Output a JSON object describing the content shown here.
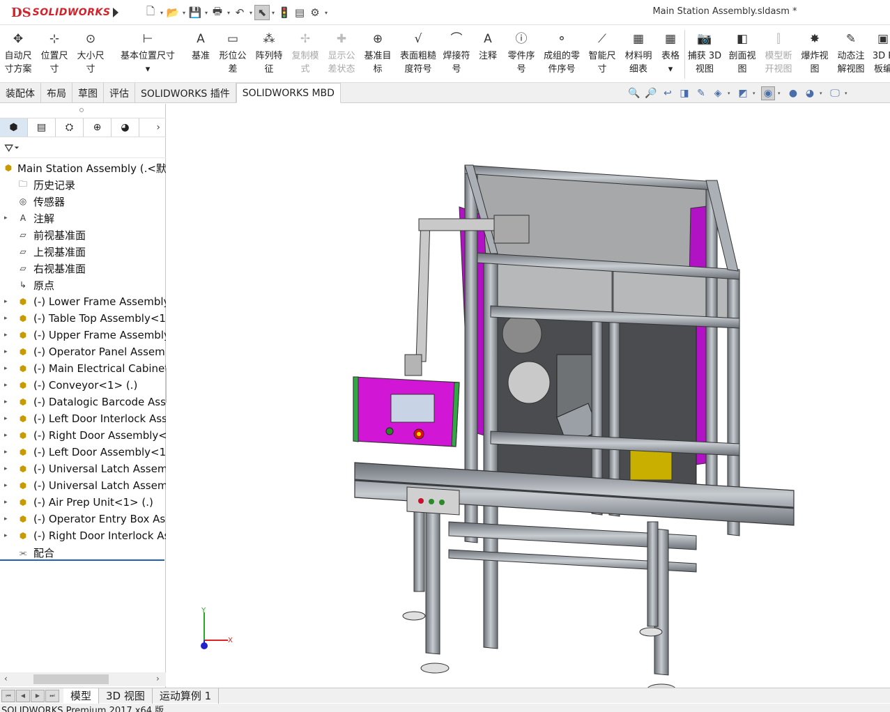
{
  "app": {
    "brand_ds": "DS",
    "brand_name": "SOLIDWORKS",
    "document_title": "Main Station Assembly.sldasm *"
  },
  "quick_access": [
    {
      "name": "new-icon",
      "glyph": "🗋"
    },
    {
      "name": "open-icon",
      "glyph": "📂"
    },
    {
      "name": "save-icon",
      "glyph": "💾"
    },
    {
      "name": "print-icon",
      "glyph": "🖶"
    },
    {
      "name": "undo-icon",
      "glyph": "↶"
    },
    {
      "name": "select-icon",
      "glyph": "⬉"
    },
    {
      "name": "rebuild-icon",
      "glyph": "🚦"
    },
    {
      "name": "file-properties-icon",
      "glyph": "▤"
    },
    {
      "name": "options-icon",
      "glyph": "⚙"
    }
  ],
  "ribbon": [
    {
      "l1": "自动尺",
      "l2": "寸方案",
      "icon": "auto-dimension-icon",
      "glyph": "✥"
    },
    {
      "l1": "位置尺",
      "l2": "寸",
      "icon": "location-dimension-icon",
      "glyph": "⊹"
    },
    {
      "l1": "大小尺",
      "l2": "寸",
      "icon": "size-dimension-icon",
      "glyph": "⊙"
    },
    {
      "l1": "基本位置尺寸",
      "l2": "▾",
      "icon": "basic-location-dimension-icon",
      "glyph": "⊢"
    },
    {
      "l1": "基准",
      "l2": "",
      "icon": "datum-icon",
      "glyph": "A"
    },
    {
      "l1": "形位公",
      "l2": "差",
      "icon": "geometric-tolerance-icon",
      "glyph": "▭"
    },
    {
      "l1": "阵列特",
      "l2": "征",
      "icon": "pattern-feature-icon",
      "glyph": "⁂"
    },
    {
      "l1": "复制模",
      "l2": "式",
      "icon": "copy-scheme-icon",
      "glyph": "✢",
      "disabled": true
    },
    {
      "l1": "显示公",
      "l2": "差状态",
      "icon": "show-tolerance-status-icon",
      "glyph": "✚",
      "disabled": true
    },
    {
      "l1": "基准目",
      "l2": "标",
      "icon": "datum-target-icon",
      "glyph": "⊕"
    },
    {
      "l1": "表面粗糙",
      "l2": "度符号",
      "icon": "surface-finish-icon",
      "glyph": "√"
    },
    {
      "l1": "焊接符",
      "l2": "号",
      "icon": "weld-symbol-icon",
      "glyph": "⌒"
    },
    {
      "l1": "注释",
      "l2": "",
      "icon": "note-icon",
      "glyph": "A"
    },
    {
      "l1": "零件序",
      "l2": "号",
      "icon": "balloon-icon",
      "glyph": "ⓘ"
    },
    {
      "l1": "成组的零",
      "l2": "件序号",
      "icon": "stacked-balloon-icon",
      "glyph": "⚬"
    },
    {
      "l1": "智能尺",
      "l2": "寸",
      "icon": "smart-dimension-icon",
      "glyph": "⟋"
    },
    {
      "l1": "材料明",
      "l2": "细表",
      "icon": "bom-icon",
      "glyph": "▦"
    },
    {
      "l1": "表格",
      "l2": "▾",
      "icon": "table-icon",
      "glyph": "▦"
    },
    {
      "sep": true
    },
    {
      "l1": "捕获 3D",
      "l2": "视图",
      "icon": "capture-3d-view-icon",
      "glyph": "📷"
    },
    {
      "l1": "剖面视",
      "l2": "图",
      "icon": "section-view-icon",
      "glyph": "◧"
    },
    {
      "l1": "模型断",
      "l2": "开视图",
      "icon": "model-break-view-icon",
      "glyph": "⫿",
      "disabled": true
    },
    {
      "l1": "爆炸视",
      "l2": "图",
      "icon": "exploded-view-icon",
      "glyph": "✸"
    },
    {
      "l1": "动态注",
      "l2": "解视图",
      "icon": "dynamic-annotation-view-icon",
      "glyph": "✎"
    },
    {
      "l1": "3D P",
      "l2": "板编",
      "icon": "3d-pdf-icon",
      "glyph": "▣"
    }
  ],
  "tabs": [
    "装配体",
    "布局",
    "草图",
    "评估",
    "SOLIDWORKS 插件",
    "SOLIDWORKS MBD"
  ],
  "active_tab": 5,
  "view_tools": [
    {
      "name": "zoom-to-fit-icon",
      "glyph": "🔍"
    },
    {
      "name": "zoom-to-area-icon",
      "glyph": "🔎"
    },
    {
      "name": "previous-view-icon",
      "glyph": "↩"
    },
    {
      "name": "section-view-toggle-icon",
      "glyph": "◨"
    },
    {
      "name": "dynamic-annotation-icon",
      "glyph": "✎"
    },
    {
      "name": "view-orientation-icon",
      "glyph": "◈",
      "dd": true
    },
    {
      "name": "display-style-icon",
      "glyph": "◩",
      "dd": true
    },
    {
      "name": "hide-show-icon",
      "glyph": "◉",
      "dd": true,
      "sel": true
    },
    {
      "name": "edit-appearance-icon",
      "glyph": "●"
    },
    {
      "name": "apply-scene-icon",
      "glyph": "◕",
      "dd": true
    },
    {
      "name": "view-settings-icon",
      "glyph": "🖵",
      "dd": true
    }
  ],
  "pane_tabs": [
    {
      "name": "feature-manager-tab-icon",
      "glyph": "⬢"
    },
    {
      "name": "property-manager-tab-icon",
      "glyph": "▤"
    },
    {
      "name": "configuration-manager-tab-icon",
      "glyph": "⛭"
    },
    {
      "name": "dimxpert-manager-tab-icon",
      "glyph": "⊕"
    },
    {
      "name": "display-manager-tab-icon",
      "glyph": "◕"
    }
  ],
  "filter_glyph": "⏷",
  "tree": {
    "root": "Main Station Assembly  (.<默",
    "items": [
      {
        "label": "历史记录",
        "icon": "history-icon",
        "glyph": "🗀",
        "exp": false
      },
      {
        "label": "传感器",
        "icon": "sensor-icon",
        "glyph": "◎",
        "exp": false
      },
      {
        "label": "注解",
        "icon": "annotations-icon",
        "glyph": "A",
        "exp": true
      },
      {
        "label": "前视基准面",
        "icon": "plane-icon",
        "glyph": "▱",
        "exp": false
      },
      {
        "label": "上视基准面",
        "icon": "plane-icon",
        "glyph": "▱",
        "exp": false
      },
      {
        "label": "右视基准面",
        "icon": "plane-icon",
        "glyph": "▱",
        "exp": false
      },
      {
        "label": "原点",
        "icon": "origin-icon",
        "glyph": "↳",
        "exp": false
      },
      {
        "label": "(-) Lower Frame Assembly",
        "icon": "subassembly-icon",
        "glyph": "⬢",
        "exp": true
      },
      {
        "label": "(-) Table Top Assembly<1",
        "icon": "subassembly-icon",
        "glyph": "⬢",
        "exp": true
      },
      {
        "label": "(-) Upper Frame Assembly",
        "icon": "subassembly-icon",
        "glyph": "⬢",
        "exp": true
      },
      {
        "label": "(-) Operator Panel Assemb",
        "icon": "subassembly-icon",
        "glyph": "⬢",
        "exp": true
      },
      {
        "label": "(-) Main Electrical Cabinet",
        "icon": "subassembly-icon",
        "glyph": "⬢",
        "exp": true
      },
      {
        "label": "(-) Conveyor<1> (.)",
        "icon": "subassembly-icon",
        "glyph": "⬢",
        "exp": true
      },
      {
        "label": "(-) Datalogic Barcode Asse",
        "icon": "subassembly-icon",
        "glyph": "⬢",
        "exp": true
      },
      {
        "label": "(-) Left Door Interlock Ass",
        "icon": "subassembly-icon",
        "glyph": "⬢",
        "exp": true
      },
      {
        "label": "(-) Right Door Assembly<",
        "icon": "subassembly-icon",
        "glyph": "⬢",
        "exp": true
      },
      {
        "label": "(-) Left Door Assembly<1:",
        "icon": "subassembly-icon",
        "glyph": "⬢",
        "exp": true
      },
      {
        "label": "(-) Universal Latch Assemb",
        "icon": "subassembly-icon",
        "glyph": "⬢",
        "exp": true
      },
      {
        "label": "(-) Universal Latch Assemb",
        "icon": "subassembly-icon",
        "glyph": "⬢",
        "exp": true
      },
      {
        "label": "(-) Air Prep Unit<1> (.)",
        "icon": "subassembly-icon",
        "glyph": "⬢",
        "exp": true
      },
      {
        "label": "(-) Operator Entry Box Ass",
        "icon": "subassembly-icon",
        "glyph": "⬢",
        "exp": true
      },
      {
        "label": "(-) Right Door Interlock As",
        "icon": "subassembly-icon",
        "glyph": "⬢",
        "exp": true
      },
      {
        "label": "配合",
        "icon": "mates-icon",
        "glyph": "⫘",
        "exp": false
      }
    ]
  },
  "triad": {
    "x": "X",
    "y": "Y"
  },
  "bottom_tabs": [
    "模型",
    "3D 视图",
    "运动算例 1"
  ],
  "active_bottom_tab": 0,
  "status": "SOLIDWORKS Premium 2017 x64 版",
  "colors": {
    "brand": "#d2232a",
    "frame": "#9da3aa",
    "frame_dark": "#5c6168",
    "panel_magenta": "#b012c4",
    "panel_grey": "#cfcfcf",
    "cabinet_green": "#31a843",
    "axis_x": "#d22",
    "axis_y": "#2a2",
    "axis_z": "#22c"
  }
}
